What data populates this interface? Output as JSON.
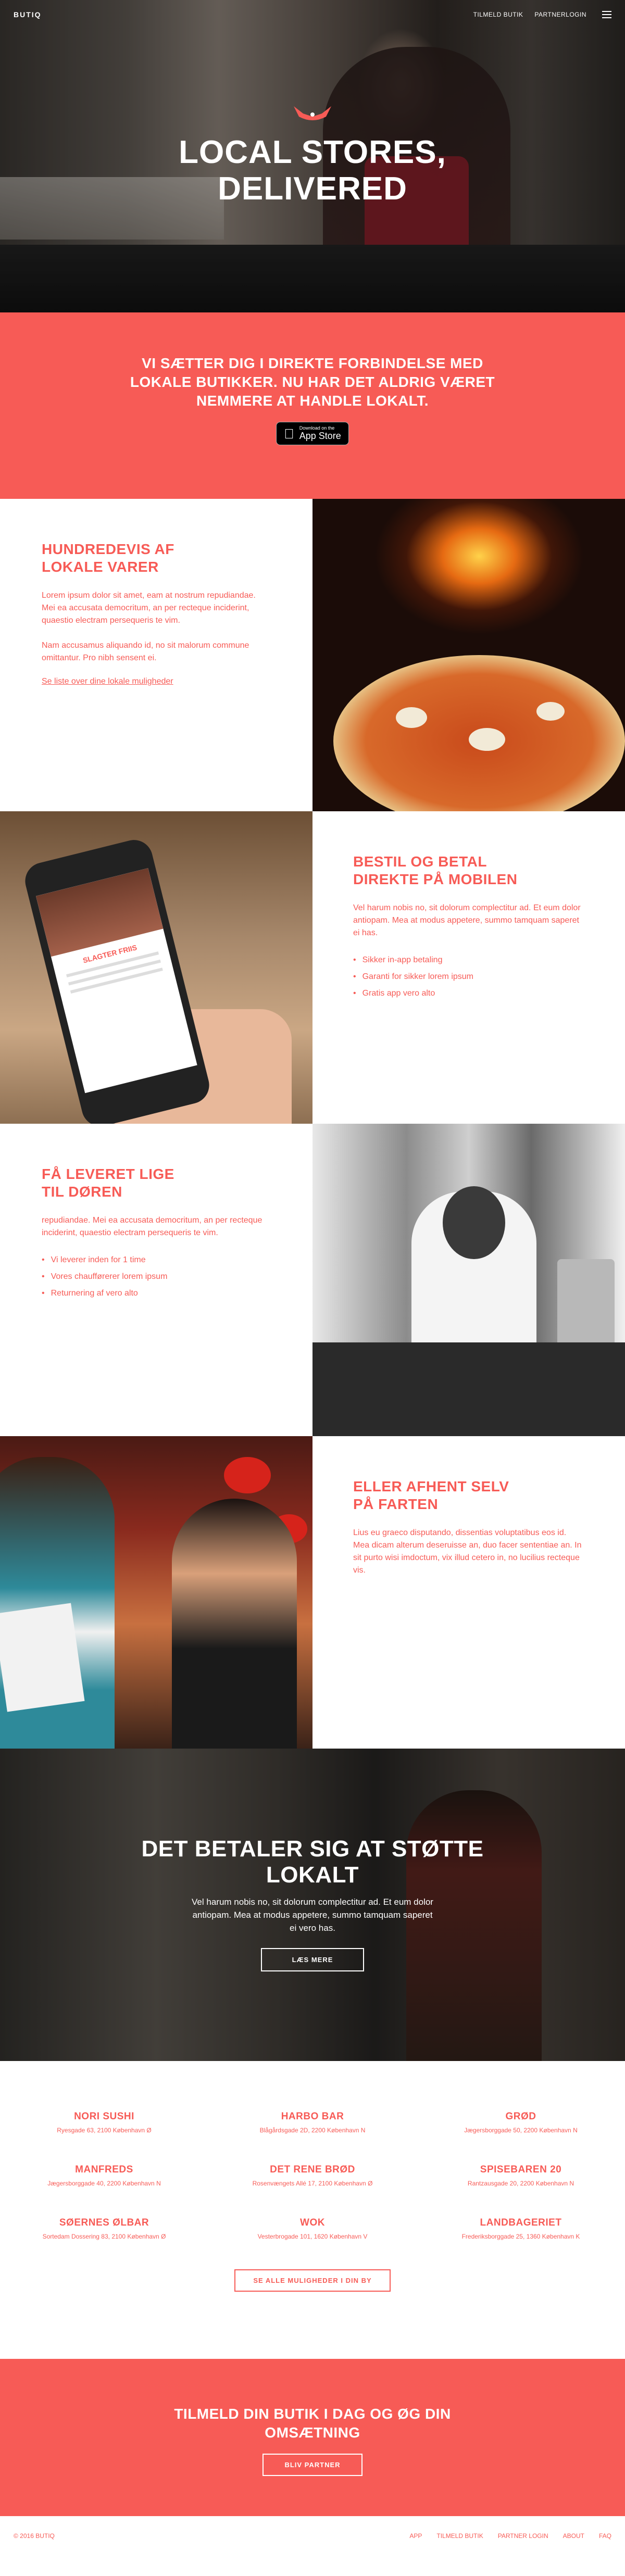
{
  "header": {
    "logo": "BUTIQ",
    "nav": [
      "TILMELD BUTIK",
      "PARTNERLOGIN"
    ]
  },
  "hero": {
    "title_line1": "LOCAL STORES,",
    "title_line2": "DELIVERED"
  },
  "banner": {
    "line1": "VI SÆTTER DIG I DIREKTE FORBINDELSE MED",
    "line2": "LOKALE BUTIKKER. NU HAR DET ALDRIG VÆRET",
    "line3": "NEMMERE AT HANDLE LOKALT.",
    "appstore_small": "Download on the",
    "appstore_big": "App Store"
  },
  "features": {
    "f1": {
      "title_line1": "HUNDREDEVIS AF",
      "title_line2": "LOKALE VARER",
      "p1": "Lorem ipsum dolor sit amet, eam at nostrum repudiandae. Mei ea accusata democritum, an per recteque inciderint, quaestio electram persequeris te vim.",
      "p2": "Nam accusamus aliquando id, no sit malorum commune omittantur. Pro nibh sensent ei.",
      "link": "Se liste over dine lokale muligheder"
    },
    "f2": {
      "title_line1": "BESTIL OG BETAL",
      "title_line2": "DIREKTE PÅ MOBILEN",
      "p1": "Vel harum nobis no, sit dolorum complectitur ad. Et eum dolor antiopam. Mea at modus appetere, summo tamquam saperet ei has.",
      "items": [
        "Sikker in-app betaling",
        "Garanti for sikker lorem ipsum",
        "Gratis app vero alto"
      ],
      "phone_text": "SLAGTER FRIIS"
    },
    "f3": {
      "title_line1": "FÅ LEVERET LIGE",
      "title_line2": "TIL DØREN",
      "p1": "repudiandae. Mei ea accusata democritum, an per recteque inciderint, quaestio electram persequeris te vim.",
      "items": [
        "Vi leverer inden for 1 time",
        "Vores chaufførerer lorem ipsum",
        "Returnering af vero alto"
      ]
    },
    "f4": {
      "title_line1": "ELLER AFHENT SELV",
      "title_line2": "PÅ FARTEN",
      "p1": "Lius eu graeco disputando, dissentias voluptatibus eos id. Mea dicam alterum deseruisse an, duo facer sententiae an. In sit purto wisi imdoctum, vix illud cetero in, no lucilius recteque vis."
    }
  },
  "support": {
    "title_line1": "DET BETALER SIG AT STØTTE",
    "title_line2": "LOKALT",
    "text": "Vel harum nobis no, sit dolorum complectitur ad. Et eum dolor antiopam. Mea at modus appetere, summo tamquam saperet ei vero has.",
    "button": "LÆS MERE"
  },
  "stores": {
    "items": [
      {
        "name": "NORI SUSHI",
        "address": "Ryesgade 63, 2100 København Ø"
      },
      {
        "name": "HARBO BAR",
        "address": "Blågårdsgade 2D, 2200 København N"
      },
      {
        "name": "GRØD",
        "address": "Jægersborggade 50, 2200 København N"
      },
      {
        "name": "MANFREDS",
        "address": "Jægersborggade 40, 2200 København N"
      },
      {
        "name": "DET RENE BRØD",
        "address": "Rosenvængets Allé 17, 2100 København Ø"
      },
      {
        "name": "SPISEBAREN 20",
        "address": "Rantzausgade 20, 2200 København N"
      },
      {
        "name": "SØERNES ØLBAR",
        "address": "Sortedam Dossering 83, 2100 København Ø"
      },
      {
        "name": "WOK",
        "address": "Vesterbrogade 101, 1620 København V"
      },
      {
        "name": "LANDBAGERIET",
        "address": "Frederiksborggade 25, 1360 København K"
      }
    ],
    "button": "SE ALLE MULIGHEDER I DIN BY"
  },
  "signup": {
    "title_line1": "TILMELD DIN BUTIK I DAG OG ØG DIN",
    "title_line2": "OMSÆTNING",
    "button": "BLIV PARTNER"
  },
  "footer": {
    "copyright": "© 2016 BUTIQ",
    "links": [
      "APP",
      "TILMELD BUTIK",
      "PARTNER LOGIN",
      "ABOUT",
      "FAQ"
    ]
  },
  "colors": {
    "accent": "#f75b56",
    "white": "#ffffff"
  }
}
